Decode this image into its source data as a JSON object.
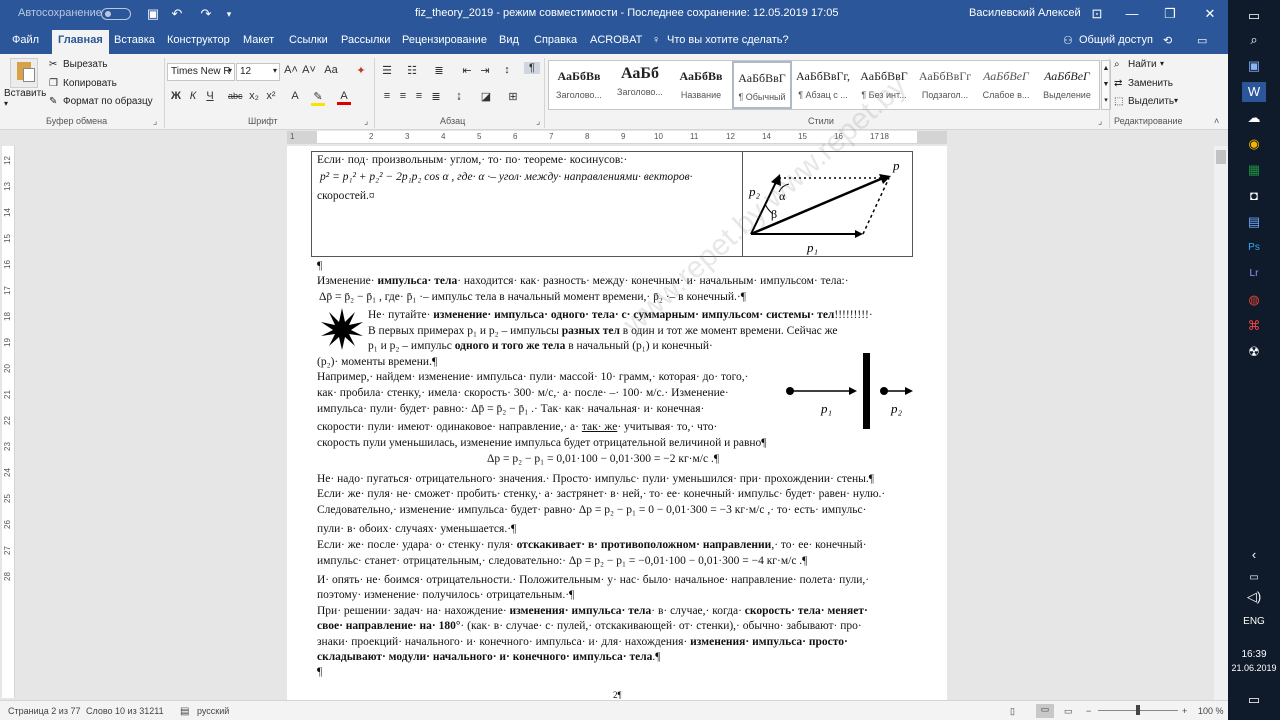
{
  "titlebar": {
    "autosave": "Автосохранение",
    "doc_title": "fiz_theory_2019  -  режим совместимости  -  Последнее сохранение: 12.05.2019 17:05",
    "user": "Василевский Алексей"
  },
  "tabs": [
    "Файл",
    "Главная",
    "Вставка",
    "Конструктор",
    "Макет",
    "Ссылки",
    "Рассылки",
    "Рецензирование",
    "Вид",
    "Справка",
    "ACROBAT"
  ],
  "tell_me": "Что вы хотите сделать?",
  "share": "Общий доступ",
  "clipboard": {
    "paste": "Вставить",
    "cut": "Вырезать",
    "copy": "Копировать",
    "format": "Формат по образцу",
    "label": "Буфер обмена"
  },
  "font": {
    "name": "Times New R",
    "size": "12",
    "label": "Шрифт"
  },
  "paragraph_label": "Абзац",
  "styles": {
    "label": "Стили",
    "items": [
      {
        "sample": "АаБбВв",
        "name": "Заголово..."
      },
      {
        "sample": "АаБб",
        "name": "Заголово..."
      },
      {
        "sample": "АаБбВв",
        "name": "Название"
      },
      {
        "sample": "АаБбВвГ",
        "name": "¶ Обычный"
      },
      {
        "sample": "АаБбВвГг,",
        "name": "¶ Абзац с ..."
      },
      {
        "sample": "АаБбВвГ",
        "name": "¶ Без инт..."
      },
      {
        "sample": "АаБбВвГг",
        "name": "Подзагол..."
      },
      {
        "sample": "АаБбВеГ",
        "name": "Слабое в..."
      },
      {
        "sample": "АаБбВеГ",
        "name": "Выделение"
      }
    ]
  },
  "editing": {
    "find": "Найти",
    "replace": "Заменить",
    "select": "Выделить",
    "label": "Редактирование"
  },
  "document": {
    "l1": "Если· под· произвольным· углом,· то· по· теореме· косинусов:·",
    "l2": "p² = p₁² + p₂² − 2p₁p₂ cos α , где· α ·– угол· между· направлениями· векторов·",
    "l3": "скоростей.¤",
    "l4": "¶",
    "l5a": "Изменение· ",
    "l5b": "импульса· тела",
    "l5c": "· находится· как· разность· между· конечным· и· начальным· импульсом· тела:·",
    "l6": "Δp̄ = p̄₂ − p̄₁ , где· p̄₁ ·– импульс тела в начальный момент времени,· p̄₂ ·– в конечный.·¶",
    "l7a": "Не· путайте· ",
    "l7b": "изменение· импульса· одного· тела· с· суммарным· импульсом· системы· тел",
    "l7c": "!!!!!!!!!·",
    "l8a": "В первых примерах p₁ и p₂ – импульсы ",
    "l8b": "разных тел",
    "l8c": " в один и тот же момент времени. Сейчас же",
    "l9a": "p₁ и p₂ – импульс ",
    "l9b": "одного и того же тела",
    "l9c": " в начальный (p₁) и конечный·",
    "l10": "(p₂)· моменты времени.¶",
    "l11": "Например,· найдем· изменение· импульса· пули· массой· 10· грамм,· которая· до· того,·",
    "l12": "как· пробила· стенку,· имела· скорость· 300· м/с,· а· после· –· 100· м/с.· Изменение·",
    "l13": "импульса·  пули·  будет·  равно:·  Δp̄ = p̄₂ − p̄₁ .·  Так·  как·  начальная·  и·  конечная·",
    "l14a": "скорости·  пули·  имеют·  одинаковое·  направление,·  а·  ",
    "l14b": "так· же",
    "l14c": "·  учитывая·  то,·  что·",
    "l15": "скорость пули уменьшилась, изменение импульса будет отрицательной величиной и равно¶",
    "l16": "Δp = p₂ − p₁ = 0,01·100 − 0,01·300 = −2 кг·м/с .¶",
    "l17": "Не· надо· пугаться· отрицательного· значения.· Просто· импульс· пули· уменьшился· при· прохождении· стены.¶",
    "l18": "Если· же· пуля· не· сможет· пробить· стенку,· а· застрянет· в· ней,· то· ее· конечный· импульс· будет· равен· нулю.·",
    "l19": "Следовательно,· изменение· импульса· будет· равно· Δp = p₂ − p₁ = 0 − 0,01·300 = −3 кг·м/с ,· то· есть· импульс·",
    "l20": "пули· в· обоих· случаях· уменьшается.·¶",
    "l21a": "Если· же· после· удара· о· стенку· пуля· ",
    "l21b": "отскакивает· в· противоположном· направлении",
    "l21c": ",· то· ее· конечный·",
    "l22": "импульс· станет· отрицательным,· следовательно:· Δp = p₂ − p₁ = −0,01·100 − 0,01·300 = −4 кг·м/с .¶",
    "l23": "И· опять· не· боимся· отрицательности.· Положительным· у· нас· было· начальное· направление· полета· пули,·",
    "l24": "поэтому· изменение· получилось· отрицательным.·¶",
    "l25a": "При· решении· задач· на· нахождение· ",
    "l25b": "изменения· импульса· тела",
    "l25c": "· в· случае,· когда· ",
    "l25d": "скорость· тела· меняет·",
    "l26a": "свое· направление· на· 180°",
    "l26b": "· (как· в· случае· с· пулей,· отскакивающей· от· стенки),· обычно· забывают· про·",
    "l27a": "знаки· проекций· начального· и· конечного· импульса· и· для· нахождения· ",
    "l27b": "изменения· импульса· просто·",
    "l28a": "складывают· модули· начального· и· конечного· импульса· тела",
    "l28b": ".¶",
    "l29": "¶",
    "page_num": "2¶",
    "fig1": {
      "p": "p",
      "p1": "p₁",
      "p2": "p₂",
      "alpha": "α",
      "beta": "β"
    },
    "fig2": {
      "p1": "p₁",
      "p2": "p₂"
    },
    "watermark": "www.repet.by  www.repet.by"
  },
  "status": {
    "page": "Страница 2 из 77",
    "words": "Слово 10 из 31211",
    "lang": "русский",
    "zoom": "100 %"
  },
  "taskbar": {
    "lang": "ENG",
    "time": "16:39",
    "date": "21.06.2019"
  }
}
